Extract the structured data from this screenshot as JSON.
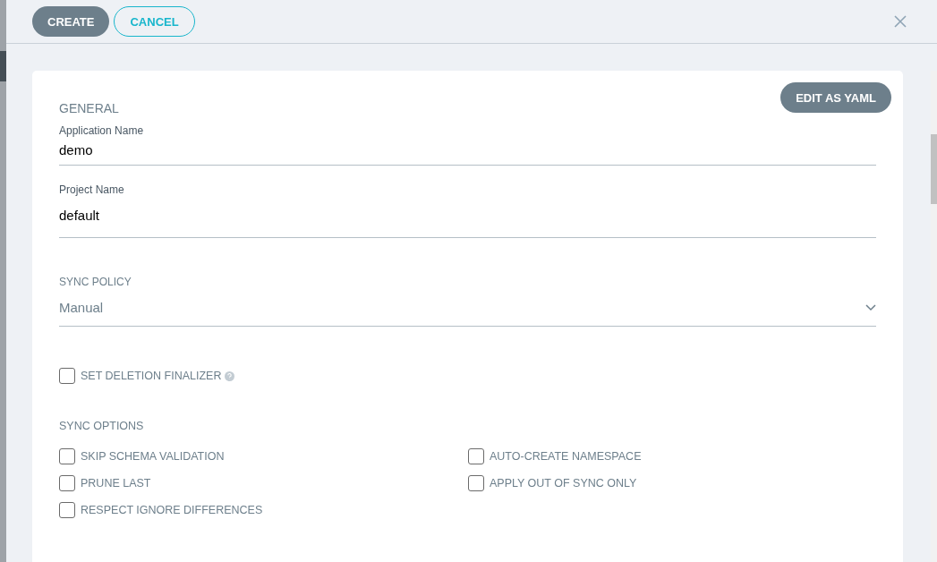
{
  "toolbar": {
    "buttons": [
      {
        "label": "CREATE",
        "kind": "primary"
      },
      {
        "label": "CANCEL",
        "kind": "outline"
      }
    ]
  },
  "card": {
    "yaml_button": "EDIT AS YAML",
    "section": "GENERAL",
    "fields": [
      {
        "label": "Application Name",
        "value": "demo",
        "kind": "text"
      },
      {
        "label": "Project Name",
        "value": "default",
        "kind": "text"
      },
      {
        "label": "SYNC POLICY",
        "value": "Manual",
        "kind": "select"
      }
    ],
    "finalizer": {
      "label": "SET DELETION FINALIZER",
      "checked": false
    },
    "sync_options": {
      "title": "SYNC OPTIONS",
      "options": [
        {
          "label": "SKIP SCHEMA VALIDATION",
          "checked": false
        },
        {
          "label": "AUTO-CREATE NAMESPACE",
          "checked": false
        },
        {
          "label": "PRUNE LAST",
          "checked": false
        },
        {
          "label": "APPLY OUT OF SYNC ONLY",
          "checked": false
        },
        {
          "label": "RESPECT IGNORE DIFFERENCES",
          "checked": false
        }
      ]
    }
  }
}
